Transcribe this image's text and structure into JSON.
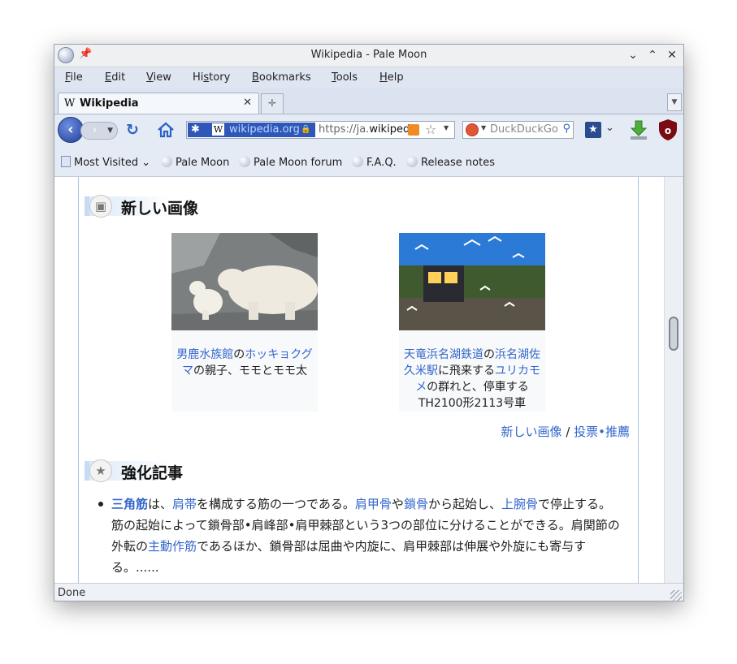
{
  "window": {
    "title": "Wikipedia - Pale Moon"
  },
  "menu": {
    "file": {
      "key": "F",
      "rest": "ile"
    },
    "edit": {
      "key": "E",
      "rest": "dit"
    },
    "view": {
      "key": "V",
      "rest": "iew"
    },
    "history": {
      "pre": "Hi",
      "key": "s",
      "rest": "tory"
    },
    "bookmarks": {
      "key": "B",
      "rest": "ookmarks"
    },
    "tools": {
      "key": "T",
      "rest": "ools"
    },
    "help": {
      "key": "H",
      "rest": "elp"
    }
  },
  "tabs": [
    {
      "icon": "W",
      "label": "Wikipedia"
    }
  ],
  "navbar": {
    "identity_domain": "wikipedia.org",
    "identity_icon": "W",
    "url_prefix": "https://ja.",
    "url_host": "wikiped",
    "search_placeholder": "DuckDuckGo"
  },
  "bookmarks": [
    {
      "label": "Most Visited"
    },
    {
      "label": "Pale Moon"
    },
    {
      "label": "Pale Moon forum"
    },
    {
      "label": "F.A.Q."
    },
    {
      "label": "Release notes"
    }
  ],
  "content": {
    "section1_title": "新しい画像",
    "image1": {
      "cap_link1": "男鹿水族館",
      "cap_t1": "の",
      "cap_link2": "ホッキョクグマ",
      "cap_t2": "の親子、モモとモモ太"
    },
    "image2": {
      "cap_link1": "天竜浜名湖鉄道",
      "cap_t1": "の",
      "cap_link2": "浜名湖佐久米駅",
      "cap_t2": "に飛来する",
      "cap_link3": "ユリカモメ",
      "cap_t3": "の群れと、停車するTH2100形2113号車"
    },
    "more_link1": "新しい画像",
    "more_sep": " / ",
    "more_link2": "投票•推薦",
    "section2_title": "強化記事",
    "article": {
      "l1": "三角筋",
      "t1": "は、",
      "l2": "肩帯",
      "t2": "を構成する筋の一つである。",
      "l3": "肩甲骨",
      "t3": "や",
      "l4": "鎖骨",
      "t4": "から起始し、",
      "l5": "上腕骨",
      "t5": "で停止する。筋の起始によって鎖骨部•肩峰部•肩甲棘部という3つの部位に分けることができる。肩関節の外転の",
      "l6": "主動作筋",
      "t6": "であるほか、鎖骨部は屈曲や内旋に、肩甲棘部は伸展や外旋にも寄与する。......"
    }
  },
  "status": {
    "text": "Done"
  }
}
